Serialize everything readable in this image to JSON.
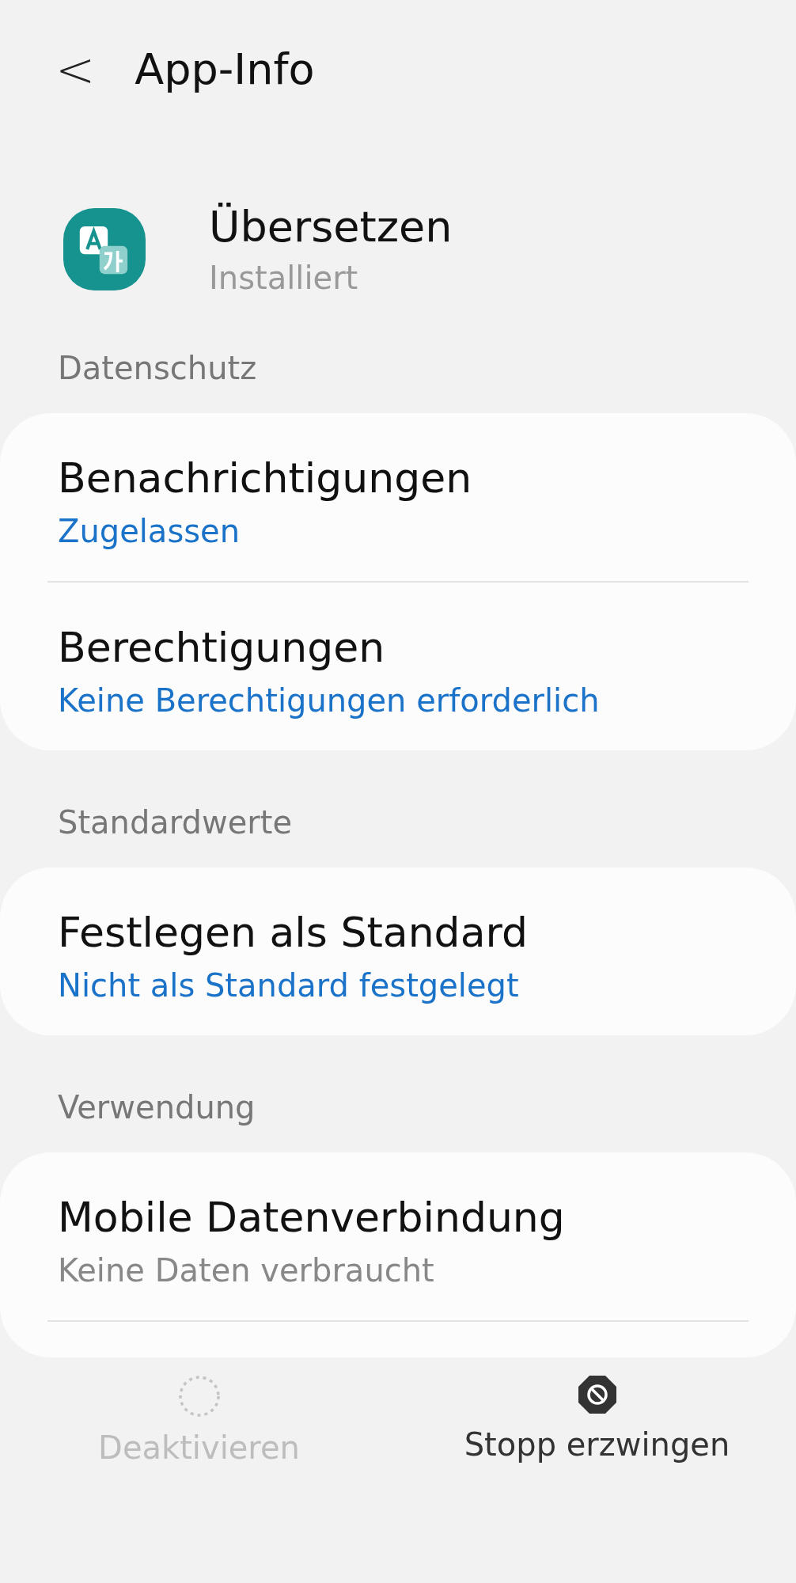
{
  "header": {
    "back_icon": "<",
    "title": "App-Info"
  },
  "app": {
    "name": "Übersetzen",
    "status": "Installiert"
  },
  "sections": [
    {
      "title": "Datenschutz",
      "items": [
        {
          "title": "Benachrichtigungen",
          "subtitle": "Zugelassen",
          "highlighted": true
        },
        {
          "title": "Berechtigungen",
          "subtitle": "Keine Berechtigungen erforderlich",
          "highlighted": true
        }
      ]
    },
    {
      "title": "Standardwerte",
      "items": [
        {
          "title": "Festlegen als Standard",
          "subtitle": "Nicht als Standard festgelegt",
          "highlighted": true
        }
      ]
    },
    {
      "title": "Verwendung",
      "cut_off": true,
      "items": [
        {
          "title": "Mobile Datenverbindung",
          "subtitle": "Keine Daten verbraucht",
          "highlighted": false
        }
      ]
    }
  ],
  "bottom_actions": [
    {
      "kind": "disable",
      "label": "Deaktivieren",
      "disabled": true
    },
    {
      "kind": "stop",
      "label": "Stopp erzwingen",
      "disabled": false
    }
  ]
}
